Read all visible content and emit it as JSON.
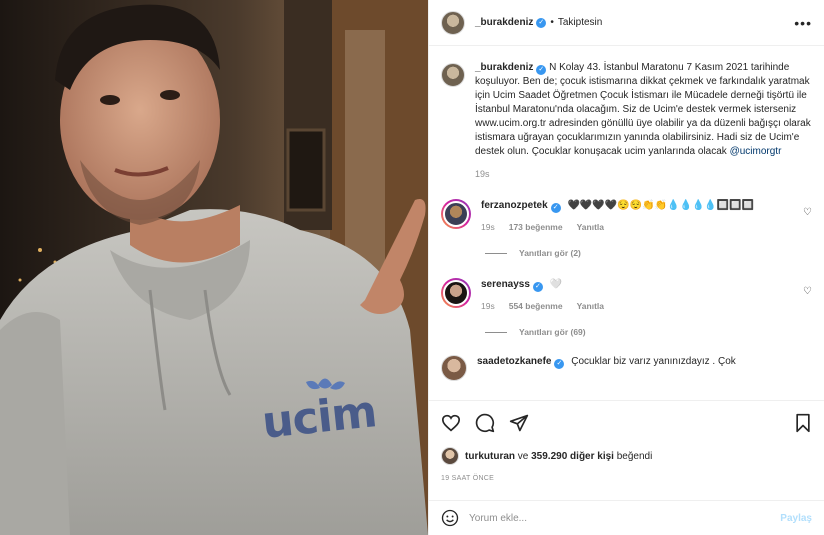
{
  "header": {
    "username": "_burakdeniz",
    "separator": "•",
    "follow_state": "Takiptesin",
    "more_label": "•••"
  },
  "caption": {
    "username": "_burakdeniz",
    "text": "N Kolay 43. İstanbul Maratonu 7 Kasım 2021 tarihinde koşuluyor. Ben de; çocuk istismarına dikkat çekmek ve farkındalık yaratmak için Ucim Saadet Öğretmen Çocuk İstismarı ile Mücadele derneği tişörtü ile İstanbul Maratonu'nda olacağım. Siz de Ucim'e destek vermek isterseniz www.ucim.org.tr adresinden gönüllü üye olabilir ya da düzenli bağışçı olarak istismara uğrayan çocuklarımızın yanında olabilirsiniz. Hadi siz de Ucim'e destek olun. Çocuklar konuşacak ucim yanlarında olacak",
    "mention": "@ucimorgtr",
    "time": "19s"
  },
  "comments": [
    {
      "username": "ferzanozpetek",
      "text": "🖤🖤🖤🖤😌😌👏👏💧💧💧💧🔲🔲🔲",
      "time": "19s",
      "likes": "173 beğenme",
      "reply_label": "Yanıtla",
      "view_replies": "Yanıtları gör (2)"
    },
    {
      "username": "serenayss",
      "text": "🤍",
      "time": "19s",
      "likes": "554 beğenme",
      "reply_label": "Yanıtla",
      "view_replies": "Yanıtları gör (69)"
    },
    {
      "username": "saadetozkanefe",
      "text": "Çocuklar biz varız yanınızdayız . Çok"
    }
  ],
  "likes": {
    "username": "turkuturan",
    "connector": "ve",
    "others": "359.290 diğer kişi",
    "suffix": "beğendi"
  },
  "timeago": "19 SAAT ÖNCE",
  "add_comment": {
    "placeholder": "Yorum ekle...",
    "share_label": "Paylaş"
  },
  "photo": {
    "logo_text": "ucim"
  },
  "colors": {
    "verified": "#3897f0",
    "mention": "#00376b",
    "muted": "#8e8e8e",
    "share_disabled": "#b2dffc",
    "hoodie": "#b9b8b3",
    "logo": "#4a5c8a"
  }
}
